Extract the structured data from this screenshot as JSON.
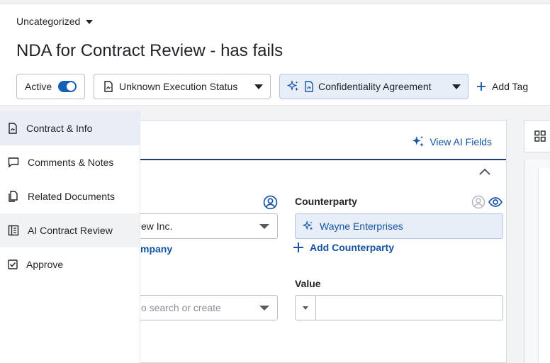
{
  "header": {
    "folder": "Uncategorized",
    "title": "NDA for Contract Review - has fails"
  },
  "chips": {
    "active_label": "Active",
    "execution_status": "Unknown Execution Status",
    "agreement_type": "Confidentiality Agreement",
    "add_tag": "Add Tag"
  },
  "sidebar": {
    "items": [
      {
        "label": "Contract & Info",
        "icon": "contract-icon"
      },
      {
        "label": "Comments & Notes",
        "icon": "comment-icon"
      },
      {
        "label": "Related Documents",
        "icon": "documents-icon"
      },
      {
        "label": "AI Contract Review",
        "icon": "ai-review-icon"
      },
      {
        "label": "Approve",
        "icon": "checkbox-icon"
      }
    ]
  },
  "panel": {
    "view_ai_fields": "View AI Fields",
    "company_value": "ew Inc.",
    "company_link": "mpany",
    "counterparty_label": "Counterparty",
    "counterparty_value": "Wayne Enterprises",
    "add_counterparty": "Add Counterparty",
    "search_placeholder": "o search or create",
    "value_label": "Value"
  },
  "colors": {
    "accent": "#1460b8",
    "link": "#1553a5",
    "ai_highlight": "#e8eef8"
  }
}
